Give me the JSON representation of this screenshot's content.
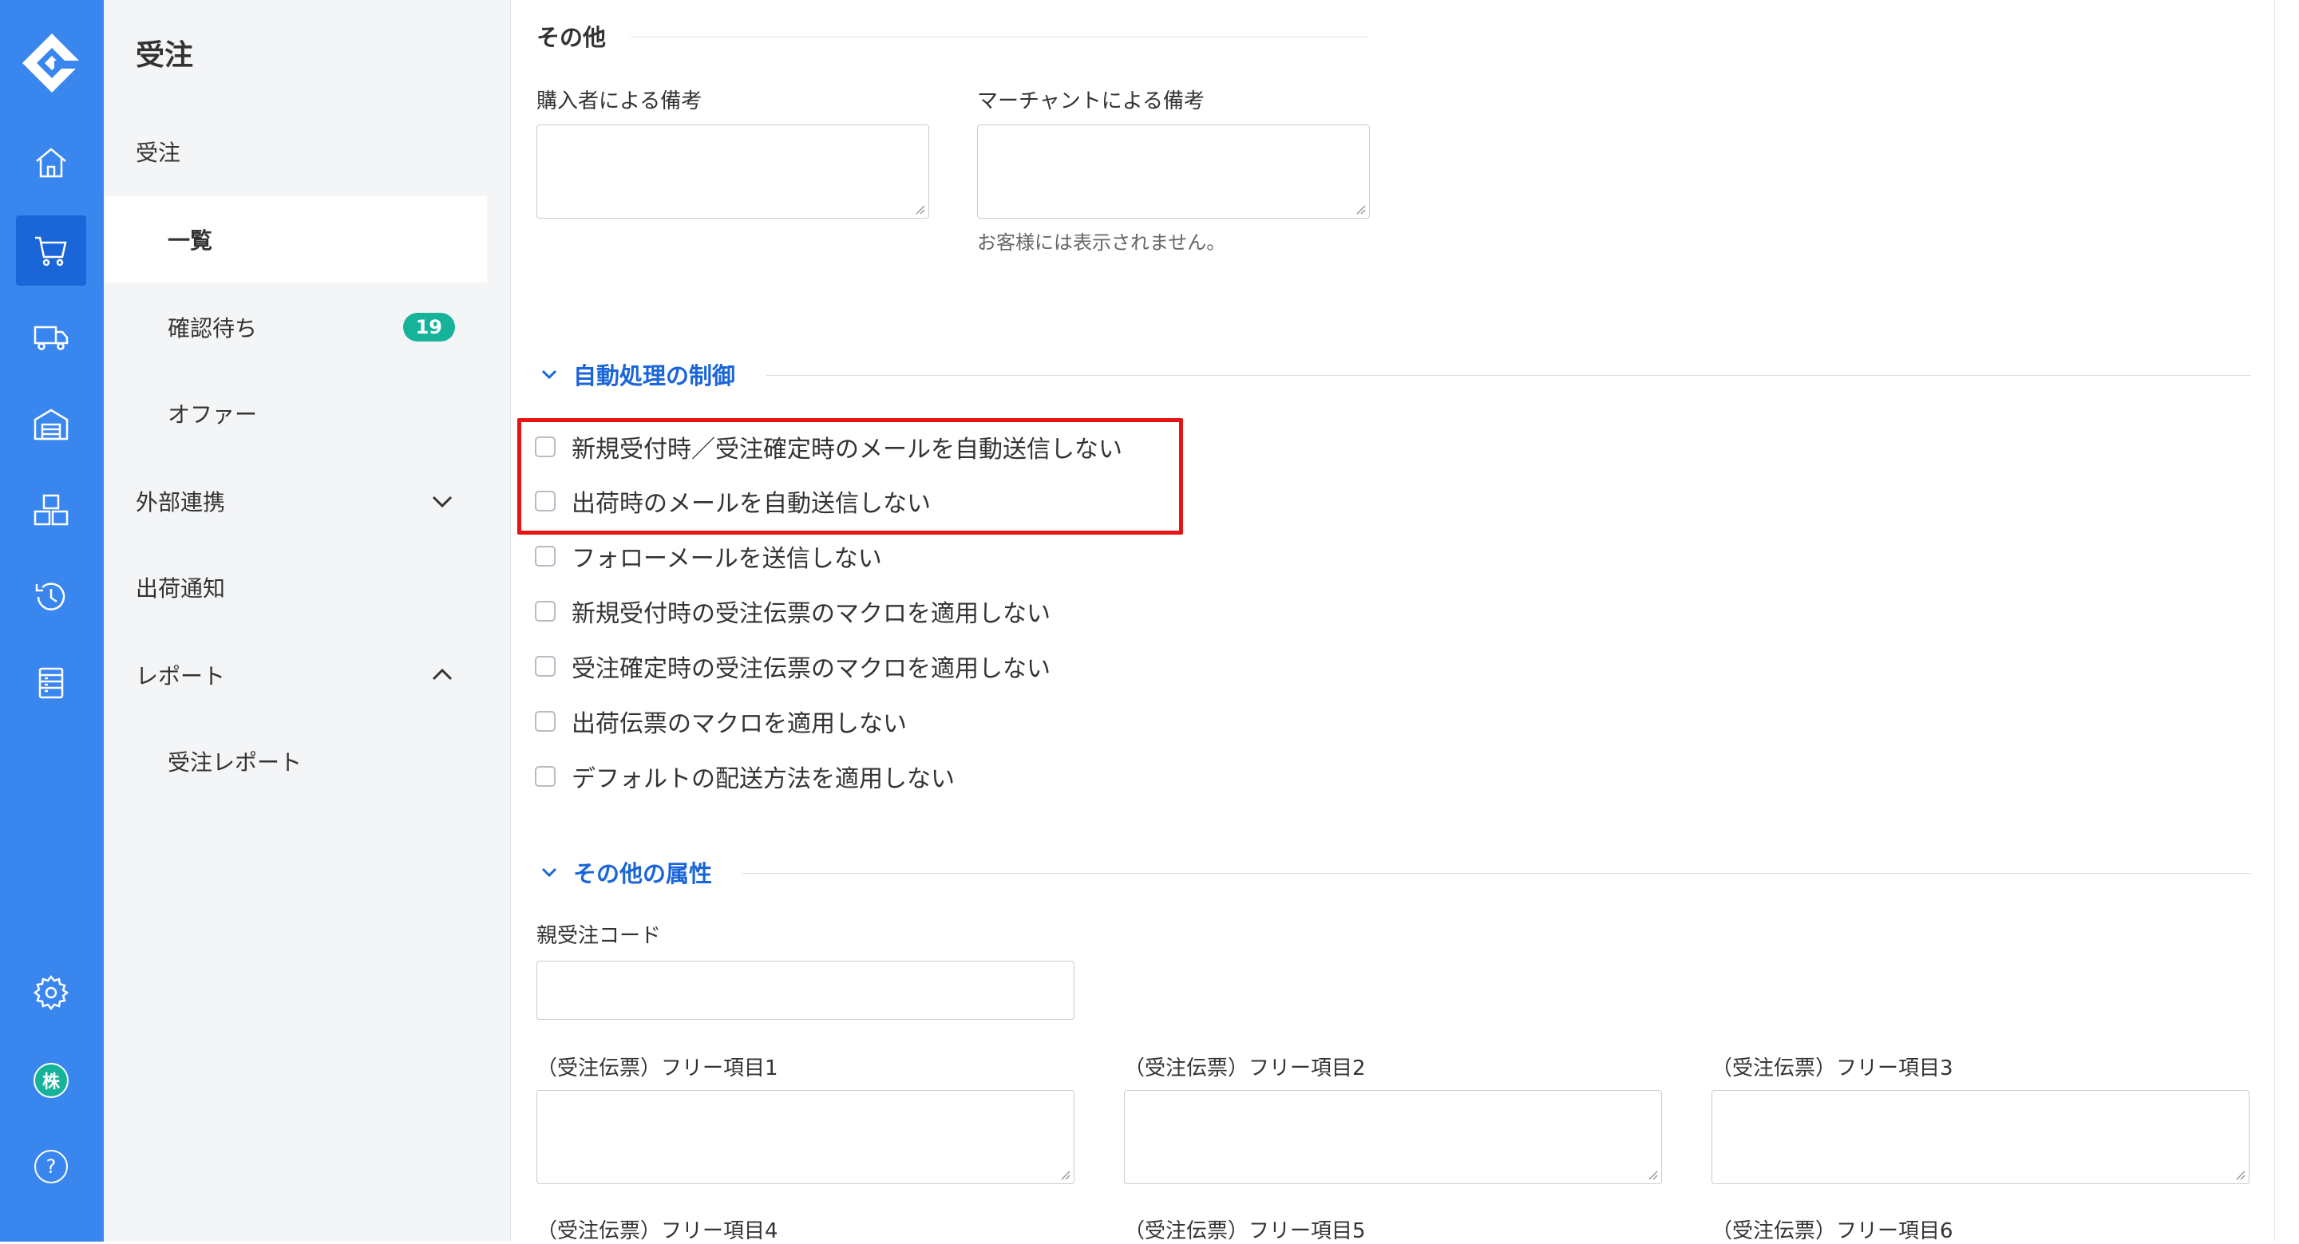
{
  "rail": {
    "icons": [
      "logo-icon",
      "home-icon",
      "cart-icon",
      "truck-icon",
      "warehouse-icon",
      "boxes-icon",
      "history-icon",
      "list-icon",
      "gear-icon",
      "company-avatar",
      "help-icon"
    ],
    "avatar_text": "株",
    "help_text": "?",
    "accent": "#3a86ef",
    "active_bg": "#1a66d8"
  },
  "sidebar": {
    "title": "受注",
    "items": [
      {
        "label": "受注"
      },
      {
        "label": "一覧"
      },
      {
        "label": "確認待ち",
        "badge": "19"
      },
      {
        "label": "オファー"
      },
      {
        "label": "外部連携"
      },
      {
        "label": "出荷通知"
      },
      {
        "label": "レポート"
      },
      {
        "label": "受注レポート"
      }
    ]
  },
  "other": {
    "heading": "その他",
    "buyer_note_label": "購入者による備考",
    "merchant_note_label": "マーチャントによる備考",
    "merchant_note_hint": "お客様には表示されません。"
  },
  "auto": {
    "heading": "自動処理の制御",
    "options": [
      "新規受付時／受注確定時のメールを自動送信しない",
      "出荷時のメールを自動送信しない",
      "フォローメールを送信しない",
      "新規受付時の受注伝票のマクロを適用しない",
      "受注確定時の受注伝票のマクロを適用しない",
      "出荷伝票のマクロを適用しない",
      "デフォルトの配送方法を適用しない"
    ],
    "highlight_color": "#e81414"
  },
  "attrs": {
    "heading": "その他の属性",
    "parent_code_label": "親受注コード",
    "free_labels": [
      "（受注伝票）フリー項目1",
      "（受注伝票）フリー項目2",
      "（受注伝票）フリー項目3",
      "（受注伝票）フリー項目4",
      "（受注伝票）フリー項目5",
      "（受注伝票）フリー項目6"
    ]
  }
}
